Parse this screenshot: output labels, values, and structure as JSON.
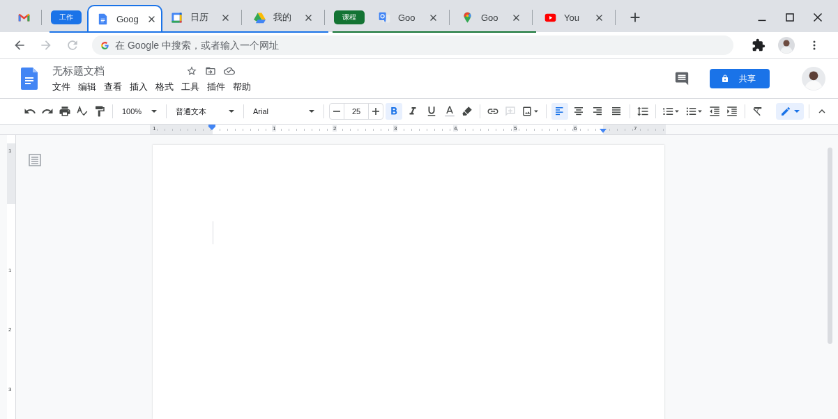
{
  "browser": {
    "tab_groups": [
      {
        "label": "工作",
        "color": "#1a73e8",
        "tabs": [
          {
            "title": "Goog",
            "selected": true
          },
          {
            "title": "日历",
            "selected": false
          },
          {
            "title": "我的",
            "selected": false
          }
        ]
      },
      {
        "label": "课程",
        "color": "#137333",
        "tabs": [
          {
            "title": "Goo",
            "selected": false
          },
          {
            "title": "Goo",
            "selected": false
          }
        ]
      }
    ],
    "tabs": [
      {
        "title": "You",
        "selected": false
      }
    ],
    "address_bar": {
      "placeholder": "在 Google 中搜索，或者输入一个网址"
    }
  },
  "document": {
    "title": "无标题文档",
    "menu": [
      "文件",
      "编辑",
      "查看",
      "插入",
      "格式",
      "工具",
      "插件",
      "帮助"
    ],
    "share_button": "共享"
  },
  "toolbar": {
    "zoom": "100%",
    "paragraph_style": "普通文本",
    "font": "Arial",
    "font_size": "25",
    "format": [
      {
        "selected": true
      },
      {
        "selected": false
      },
      {
        "selected": false
      }
    ],
    "align": [
      {
        "selected": true
      },
      {
        "selected": false
      },
      {
        "selected": false
      },
      {
        "selected": false
      }
    ]
  },
  "ruler": {
    "labels": [
      "1",
      "1",
      "2",
      "3",
      "4",
      "5",
      "6",
      "7"
    ]
  },
  "vertical_ruler": {
    "labels": [
      "1",
      "1",
      "2",
      "3"
    ]
  }
}
